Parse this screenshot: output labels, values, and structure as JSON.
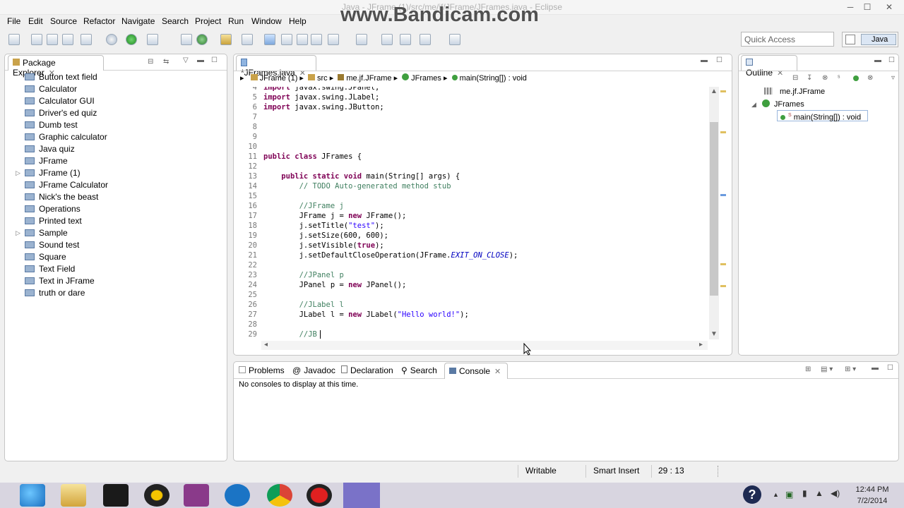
{
  "window": {
    "title": "Java - JFrame (1)/src/me/jf/JFrame/JFrames.java - Eclipse",
    "watermark": "www.Bandicam.com",
    "min": "─",
    "max": "☐",
    "close": "✕"
  },
  "menu": [
    "File",
    "Edit",
    "Source",
    "Refactor",
    "Navigate",
    "Search",
    "Project",
    "Run",
    "Window",
    "Help"
  ],
  "quick_access": {
    "placeholder": "Quick Access"
  },
  "perspective": {
    "label": "Java"
  },
  "package_explorer": {
    "title": "Package Explorer",
    "items": [
      {
        "label": "Button text field",
        "expandable": false
      },
      {
        "label": "Calculator",
        "expandable": false
      },
      {
        "label": "Calculator GUI",
        "expandable": false
      },
      {
        "label": "Driver's ed quiz",
        "expandable": false
      },
      {
        "label": "Dumb test",
        "expandable": false
      },
      {
        "label": "Graphic calculator",
        "expandable": false
      },
      {
        "label": "Java quiz",
        "expandable": false
      },
      {
        "label": "JFrame",
        "expandable": false
      },
      {
        "label": "JFrame (1)",
        "expandable": true
      },
      {
        "label": "JFrame Calculator",
        "expandable": false
      },
      {
        "label": "Nick's the beast",
        "expandable": false
      },
      {
        "label": "Operations",
        "expandable": false
      },
      {
        "label": "Printed text",
        "expandable": false
      },
      {
        "label": "Sample",
        "expandable": true
      },
      {
        "label": "Sound test",
        "expandable": false
      },
      {
        "label": "Square",
        "expandable": false
      },
      {
        "label": "Text Field",
        "expandable": false
      },
      {
        "label": "Text in JFrame",
        "expandable": false
      },
      {
        "label": "truth or dare",
        "expandable": false
      }
    ]
  },
  "editor": {
    "tab": "*JFrames.java",
    "breadcrumb": [
      "JFrame (1)",
      "src",
      "me.jf.JFrame",
      "JFrames",
      "main(String[]) : void"
    ],
    "lines": [
      {
        "n": "4",
        "parts": [
          [
            "kw",
            "import"
          ],
          [
            "t",
            " javax.swing.JPanel;"
          ]
        ]
      },
      {
        "n": "5",
        "parts": [
          [
            "kw",
            "import"
          ],
          [
            "t",
            " javax.swing.JLabel;"
          ]
        ]
      },
      {
        "n": "6",
        "parts": [
          [
            "kw",
            "import"
          ],
          [
            "t",
            " javax.swing.JButton;"
          ]
        ]
      },
      {
        "n": "7",
        "parts": []
      },
      {
        "n": "8",
        "parts": []
      },
      {
        "n": "9",
        "parts": []
      },
      {
        "n": "10",
        "parts": []
      },
      {
        "n": "11",
        "parts": [
          [
            "kw",
            "public class"
          ],
          [
            "t",
            " JFrames {"
          ]
        ]
      },
      {
        "n": "12",
        "parts": []
      },
      {
        "n": "13",
        "parts": [
          [
            "t",
            "    "
          ],
          [
            "kw",
            "public static void"
          ],
          [
            "t",
            " main(String[] args) {"
          ]
        ]
      },
      {
        "n": "14",
        "parts": [
          [
            "t",
            "        "
          ],
          [
            "cm",
            "// TODO Auto-generated method stub"
          ]
        ]
      },
      {
        "n": "15",
        "parts": []
      },
      {
        "n": "16",
        "parts": [
          [
            "t",
            "        "
          ],
          [
            "cm",
            "//JFrame j"
          ]
        ]
      },
      {
        "n": "17",
        "parts": [
          [
            "t",
            "        JFrame j = "
          ],
          [
            "kw",
            "new"
          ],
          [
            "t",
            " JFrame();"
          ]
        ]
      },
      {
        "n": "18",
        "parts": [
          [
            "t",
            "        j.setTitle("
          ],
          [
            "str",
            "\"test\""
          ],
          [
            "t",
            ");"
          ]
        ]
      },
      {
        "n": "19",
        "parts": [
          [
            "t",
            "        j.setSize(600, 600);"
          ]
        ]
      },
      {
        "n": "20",
        "parts": [
          [
            "t",
            "        j.setVisible("
          ],
          [
            "kw",
            "true"
          ],
          [
            "t",
            ");"
          ]
        ]
      },
      {
        "n": "21",
        "parts": [
          [
            "t",
            "        j.setDefaultCloseOperation(JFrame."
          ],
          [
            "itf",
            "EXIT_ON_CLOSE"
          ],
          [
            "t",
            ");"
          ]
        ]
      },
      {
        "n": "22",
        "parts": []
      },
      {
        "n": "23",
        "parts": [
          [
            "t",
            "        "
          ],
          [
            "cm",
            "//JPanel p"
          ]
        ]
      },
      {
        "n": "24",
        "parts": [
          [
            "t",
            "        JPanel p = "
          ],
          [
            "kw",
            "new"
          ],
          [
            "t",
            " JPanel();"
          ]
        ]
      },
      {
        "n": "25",
        "parts": []
      },
      {
        "n": "26",
        "parts": [
          [
            "t",
            "        "
          ],
          [
            "cm",
            "//JLabel l"
          ]
        ]
      },
      {
        "n": "27",
        "parts": [
          [
            "t",
            "        JLabel l = "
          ],
          [
            "kw",
            "new"
          ],
          [
            "t",
            " JLabel("
          ],
          [
            "str",
            "\"Hello world!\""
          ],
          [
            "t",
            ");"
          ]
        ]
      },
      {
        "n": "28",
        "parts": []
      },
      {
        "n": "29",
        "parts": [
          [
            "t",
            "        "
          ],
          [
            "cm",
            "//JB"
          ]
        ]
      }
    ]
  },
  "outline": {
    "title": "Outline",
    "items": [
      {
        "label": "me.jf.JFrame"
      },
      {
        "label": "JFrames"
      },
      {
        "label": "main(String[]) : void",
        "superscript": "S"
      }
    ]
  },
  "console": {
    "tabs": [
      "Problems",
      "Javadoc",
      "Declaration",
      "Search",
      "Console"
    ],
    "message": "No consoles to display at this time."
  },
  "status": {
    "mode": "Writable",
    "insert": "Smart Insert",
    "position": "29 : 13"
  },
  "taskbar": {
    "time": "12:44 PM",
    "date": "7/2/2014"
  }
}
